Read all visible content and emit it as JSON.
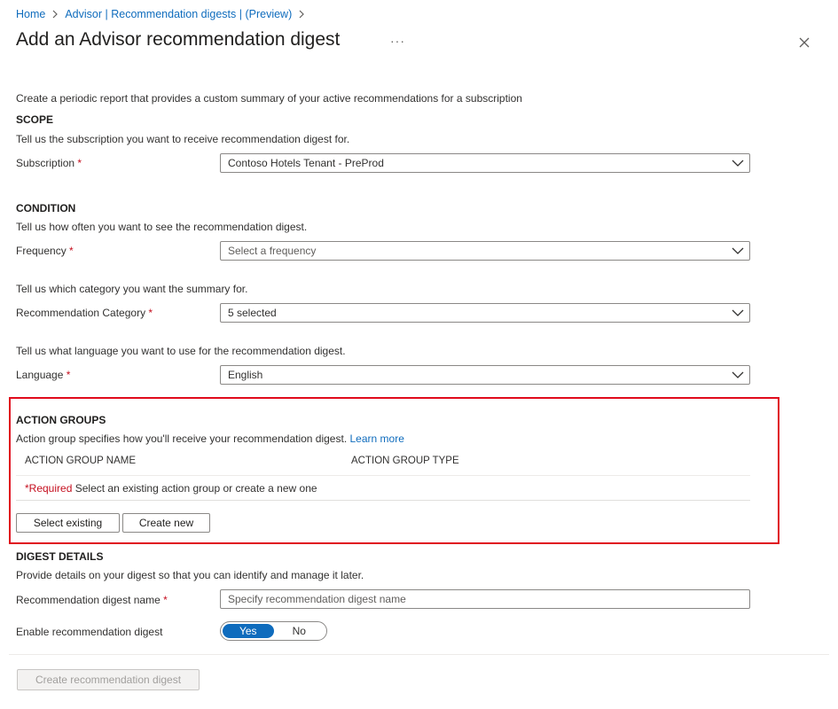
{
  "breadcrumb": {
    "home": "Home",
    "advisor": "Advisor | Recommendation digests | (Preview)"
  },
  "title": "Add an Advisor recommendation digest",
  "more_label": "···",
  "intro": "Create a periodic report that provides a custom summary of your active recommendations for a subscription",
  "scope": {
    "heading": "SCOPE",
    "description": "Tell us the subscription you want to receive recommendation digest for.",
    "subscription_label": "Subscription",
    "subscription_value": "Contoso Hotels Tenant - PreProd"
  },
  "condition": {
    "heading": "CONDITION",
    "frequency_description": "Tell us how often you want to see the recommendation digest.",
    "frequency_label": "Frequency",
    "frequency_placeholder": "Select a frequency",
    "category_description": "Tell us which category you want the summary for.",
    "category_label": "Recommendation Category",
    "category_value": "5 selected",
    "language_description": "Tell us what language you want to use for the recommendation digest.",
    "language_label": "Language",
    "language_value": "English"
  },
  "action_groups": {
    "heading": "ACTION GROUPS",
    "description": "Action group specifies how you'll receive your recommendation digest.",
    "learn_more": "Learn more",
    "col_name": "ACTION GROUP NAME",
    "col_type": "ACTION GROUP TYPE",
    "required_tag": "*Required",
    "required_text": "Select an existing action group or create a new one",
    "select_existing": "Select existing",
    "create_new": "Create new"
  },
  "digest_details": {
    "heading": "DIGEST DETAILS",
    "description": "Provide details on your digest so that you can identify and manage it later.",
    "name_label": "Recommendation digest name",
    "name_placeholder": "Specify recommendation digest name",
    "enable_label": "Enable recommendation digest",
    "toggle_yes": "Yes",
    "toggle_no": "No"
  },
  "required_marker": "*",
  "create_button": "Create recommendation digest",
  "colors": {
    "link": "#0f6cbd",
    "required": "#c50f1f",
    "highlight": "#e00b1c"
  }
}
